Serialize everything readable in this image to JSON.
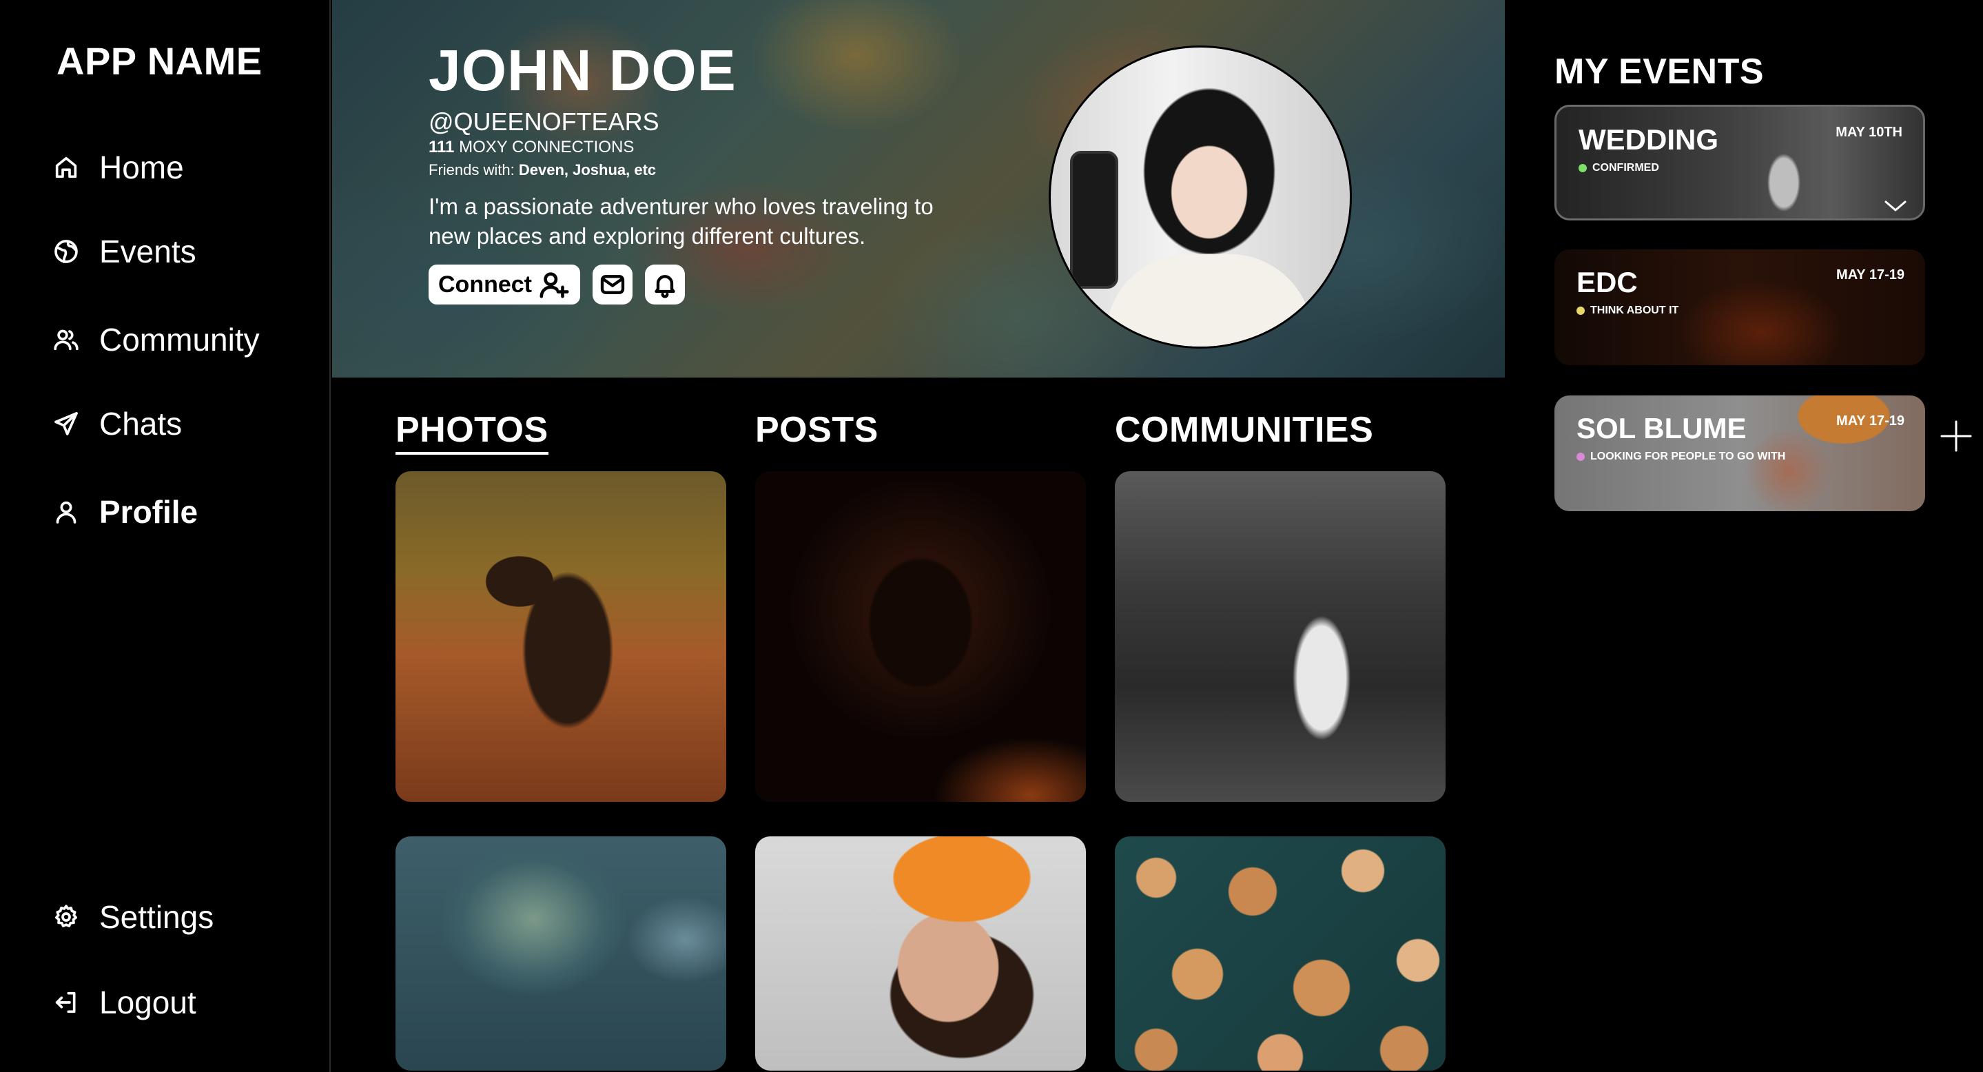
{
  "app": {
    "name": "APP NAME"
  },
  "sidebar": {
    "items": [
      {
        "label": "Home",
        "icon": "home-icon"
      },
      {
        "label": "Events",
        "icon": "globe-icon"
      },
      {
        "label": "Community",
        "icon": "users-icon"
      },
      {
        "label": "Chats",
        "icon": "send-icon"
      },
      {
        "label": "Profile",
        "icon": "user-icon",
        "active": true
      }
    ],
    "bottom": [
      {
        "label": "Settings",
        "icon": "gear-icon"
      },
      {
        "label": "Logout",
        "icon": "logout-icon"
      }
    ]
  },
  "profile": {
    "name": "JOHN DOE",
    "handle": "@QUEENOFTEARS",
    "connections_count": "111",
    "connections_label": "MOXY CONNECTIONS",
    "friends_prefix": "Friends with:",
    "friends_names": "Deven, Joshua, etc",
    "bio": "I'm a passionate adventurer who loves traveling to new places and exploring different cultures.",
    "connect_label": "Connect"
  },
  "tabs": [
    {
      "label": "PHOTOS",
      "active": true
    },
    {
      "label": "POSTS"
    },
    {
      "label": "COMMUNITIES"
    }
  ],
  "my_events": {
    "title": "MY EVENTS",
    "items": [
      {
        "name": "WEDDING",
        "date": "MAY 10TH",
        "status": "CONFIRMED",
        "status_color": "#7ee06a"
      },
      {
        "name": "EDC",
        "date": "MAY 17-19",
        "status": "THINK ABOUT IT",
        "status_color": "#e8d86a"
      },
      {
        "name": "SOL BLUME",
        "date": "MAY 17-19",
        "status": "LOOKING FOR PEOPLE TO GO WITH",
        "status_color": "#d98ad6"
      }
    ]
  }
}
